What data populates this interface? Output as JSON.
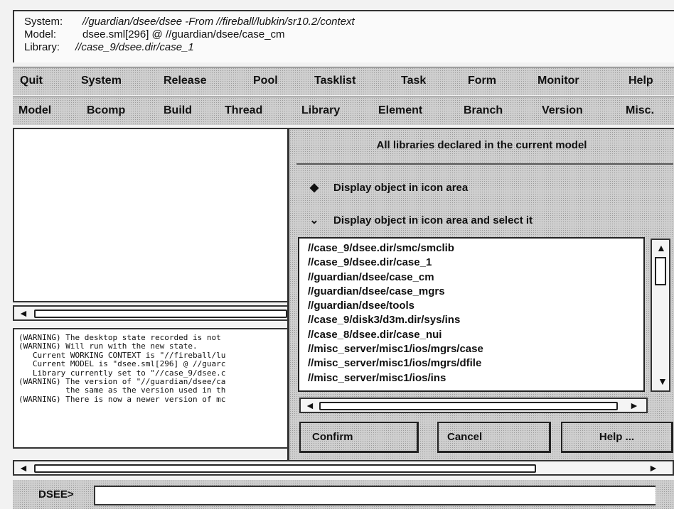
{
  "header": {
    "system_label": "System:",
    "system_value": "//guardian/dsee/dsee   -From //fireball/lubkin/sr10.2/context",
    "model_label": "Model:",
    "model_value": "dsee.sml[296] @ //guardian/dsee/case_cm",
    "library_label": "Library:",
    "library_value": "//case_9/dsee.dir/case_1"
  },
  "menu1": [
    "Quit",
    "System",
    "Release",
    "Pool",
    "Tasklist",
    "Task",
    "Form",
    "Monitor",
    "Help"
  ],
  "menu2": [
    "Model",
    "Bcomp",
    "Build",
    "Thread",
    "Library",
    "Element",
    "Branch",
    "Version",
    "Misc."
  ],
  "messages": [
    "(WARNING) The desktop state recorded is not",
    "(WARNING) Will run with the new state.",
    "   Current WORKING CONTEXT is \"//fireball/lu",
    "   Current MODEL is \"dsee.sml[296] @ //guarc",
    "   Library currently set to \"//case_9/dsee.c",
    "(WARNING) The version of \"//guardian/dsee/ca",
    "          the same as the version used in th",
    "(WARNING) There is now a newer version of mc"
  ],
  "dialog": {
    "title": "All libraries declared in the current model",
    "radio1": "Display object in icon area",
    "radio2": "Display object in icon area and select it",
    "libraries": [
      "//case_9/dsee.dir/smc/smclib",
      "//case_9/dsee.dir/case_1",
      "//guardian/dsee/case_cm",
      "//guardian/dsee/case_mgrs",
      "//guardian/dsee/tools",
      "//case_9/disk3/d3m.dir/sys/ins",
      "//case_8/dsee.dir/case_nui",
      "//misc_server/misc1/ios/mgrs/case",
      "//misc_server/misc1/ios/mgrs/dfile",
      "//misc_server/misc1/ios/ins"
    ],
    "confirm": "Confirm",
    "cancel": "Cancel",
    "help": "Help ..."
  },
  "command": {
    "prompt": "DSEE>",
    "value": ""
  }
}
